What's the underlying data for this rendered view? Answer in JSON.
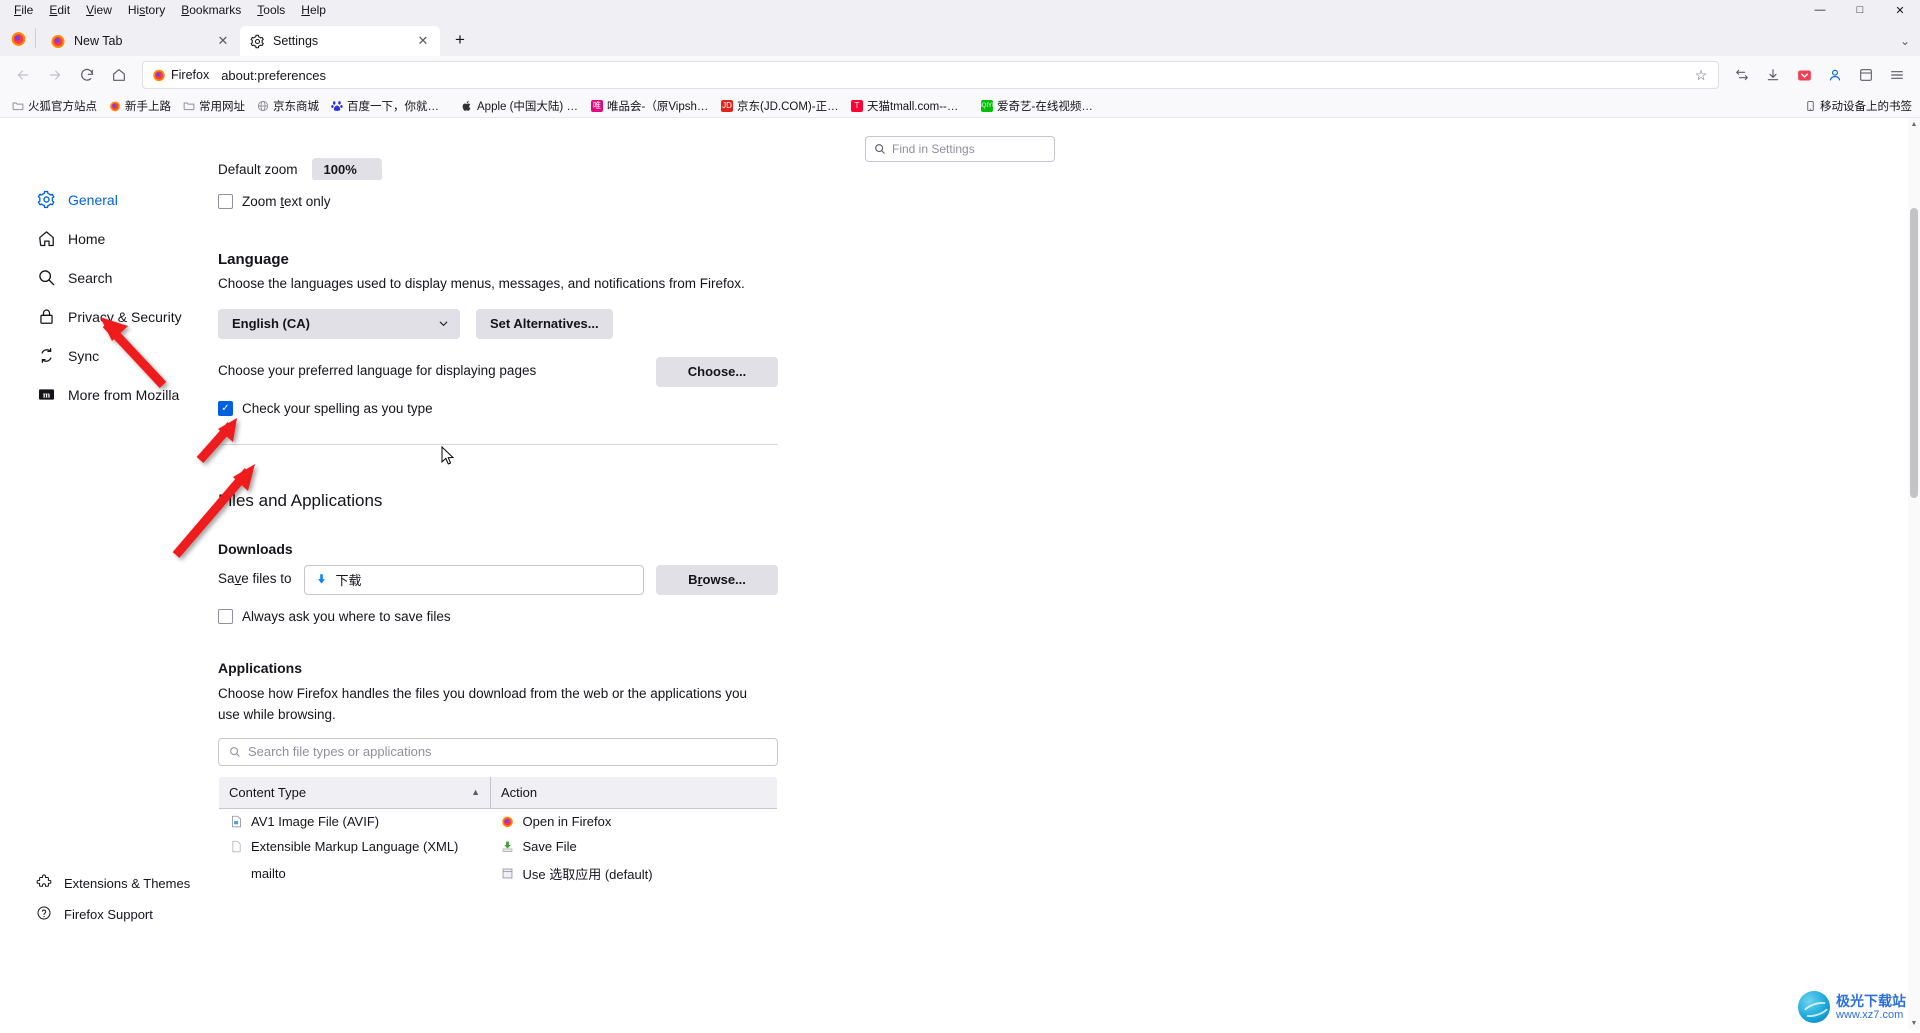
{
  "window": {
    "menus": [
      "File",
      "Edit",
      "View",
      "History",
      "Bookmarks",
      "Tools",
      "Help"
    ],
    "minimize": "—",
    "maximize": "□",
    "close": "✕"
  },
  "tabs": [
    {
      "label": "New Tab",
      "icon": "firefox-icon",
      "active": false,
      "close": "✕"
    },
    {
      "label": "Settings",
      "icon": "gear-icon",
      "active": true,
      "close": "✕"
    }
  ],
  "tabstrip": {
    "new_tab": "+",
    "list_all_tabs": "⌄"
  },
  "navbar": {
    "back": "←",
    "forward": "→",
    "reload": "⟳",
    "home": "⌂",
    "identity_badge": "Firefox",
    "url": "about:preferences",
    "bookmark_star": "☆",
    "extensions": "⇄",
    "downloads": "↧",
    "pocket": "▶",
    "account": "◔",
    "save_to_pocket": "⊡",
    "app_menu": "≡"
  },
  "bookmarks": [
    {
      "label": "火狐官方站点",
      "icon": "folder-icon",
      "color": "#8f8f9d"
    },
    {
      "label": "新手上路",
      "icon": "firefox-icon",
      "color": "#ff9500"
    },
    {
      "label": "常用网址",
      "icon": "folder-icon",
      "color": "#8f8f9d"
    },
    {
      "label": "京东商城",
      "icon": "globe-icon",
      "color": "#8f8f9d"
    },
    {
      "label": "百度一下，你就知道",
      "icon": "baidu-icon",
      "color": "#2932e1"
    },
    {
      "label": "Apple (中国大陆) - 官...",
      "icon": "apple-icon",
      "color": "#333333"
    },
    {
      "label": "唯品会-（原Vipshop....",
      "icon": "vip-icon",
      "color": "#e10a7d"
    },
    {
      "label": "京东(JD.COM)-正品...",
      "icon": "jd-icon",
      "color": "#e1251b"
    },
    {
      "label": "天猫tmall.com--理想...",
      "icon": "tmall-icon",
      "color": "#ff0036"
    },
    {
      "label": "爱奇艺-在线视频网站...",
      "icon": "iqiyi-icon",
      "color": "#00be06"
    }
  ],
  "bookmarks_right": {
    "label": "移动设备上的书签",
    "icon": "mobile-icon"
  },
  "search": {
    "placeholder": "Find in Settings",
    "icon": "search-icon"
  },
  "sidebar": {
    "items": [
      {
        "label": "General",
        "icon": "gear-icon",
        "selected": true
      },
      {
        "label": "Home",
        "icon": "home-icon",
        "selected": false
      },
      {
        "label": "Search",
        "icon": "search-icon",
        "selected": false
      },
      {
        "label": "Privacy & Security",
        "icon": "lock-icon",
        "selected": false
      },
      {
        "label": "Sync",
        "icon": "sync-icon",
        "selected": false
      },
      {
        "label": "More from Mozilla",
        "icon": "mozilla-m-icon",
        "selected": false
      }
    ],
    "bottom": [
      {
        "label": "Extensions & Themes",
        "icon": "extensions-icon"
      },
      {
        "label": "Firefox Support",
        "icon": "help-icon"
      }
    ]
  },
  "main": {
    "zoom": {
      "label": "Default zoom",
      "value": "100%"
    },
    "zoom_text_only": {
      "label": "Zoom text only",
      "checked": false
    },
    "language": {
      "heading": "Language",
      "description": "Choose the languages used to display menus, messages, and notifications from Firefox.",
      "selected": "English (CA)",
      "chevron": "⌄",
      "set_alternatives": "Set Alternatives...",
      "pages_label": "Choose your preferred language for displaying pages",
      "choose_button": "Choose...",
      "spellcheck": {
        "label": "Check your spelling as you type",
        "checked": true,
        "mark": "✓"
      }
    },
    "files_and_applications": {
      "heading": "Files and Applications",
      "downloads": {
        "heading": "Downloads",
        "save_files_label": "Save files to",
        "path_value": "下载",
        "path_icon": "download-arrow-icon",
        "browse_button": "Browse...",
        "always_ask": {
          "label": "Always ask you where to save files",
          "checked": false
        }
      },
      "applications": {
        "heading": "Applications",
        "description": "Choose how Firefox handles the files you download from the web or the applications you use while browsing.",
        "search_placeholder": "Search file types or applications",
        "columns": [
          "Content Type",
          "Action"
        ],
        "sort_arrow": "▲",
        "rows": [
          {
            "content_type": "AV1 Image File (AVIF)",
            "type_icon": "image-file-icon",
            "action": "Open in Firefox",
            "action_icon": "firefox-icon"
          },
          {
            "content_type": "Extensible Markup Language (XML)",
            "type_icon": "document-icon",
            "action": "Save File",
            "action_icon": "save-file-icon"
          },
          {
            "content_type": "mailto",
            "type_icon": "",
            "action": "Use 选取应用 (default)",
            "action_icon": "application-icon"
          }
        ]
      }
    }
  },
  "watermark": {
    "title": "极光下载站",
    "subtitle": "www.xz7.com"
  }
}
